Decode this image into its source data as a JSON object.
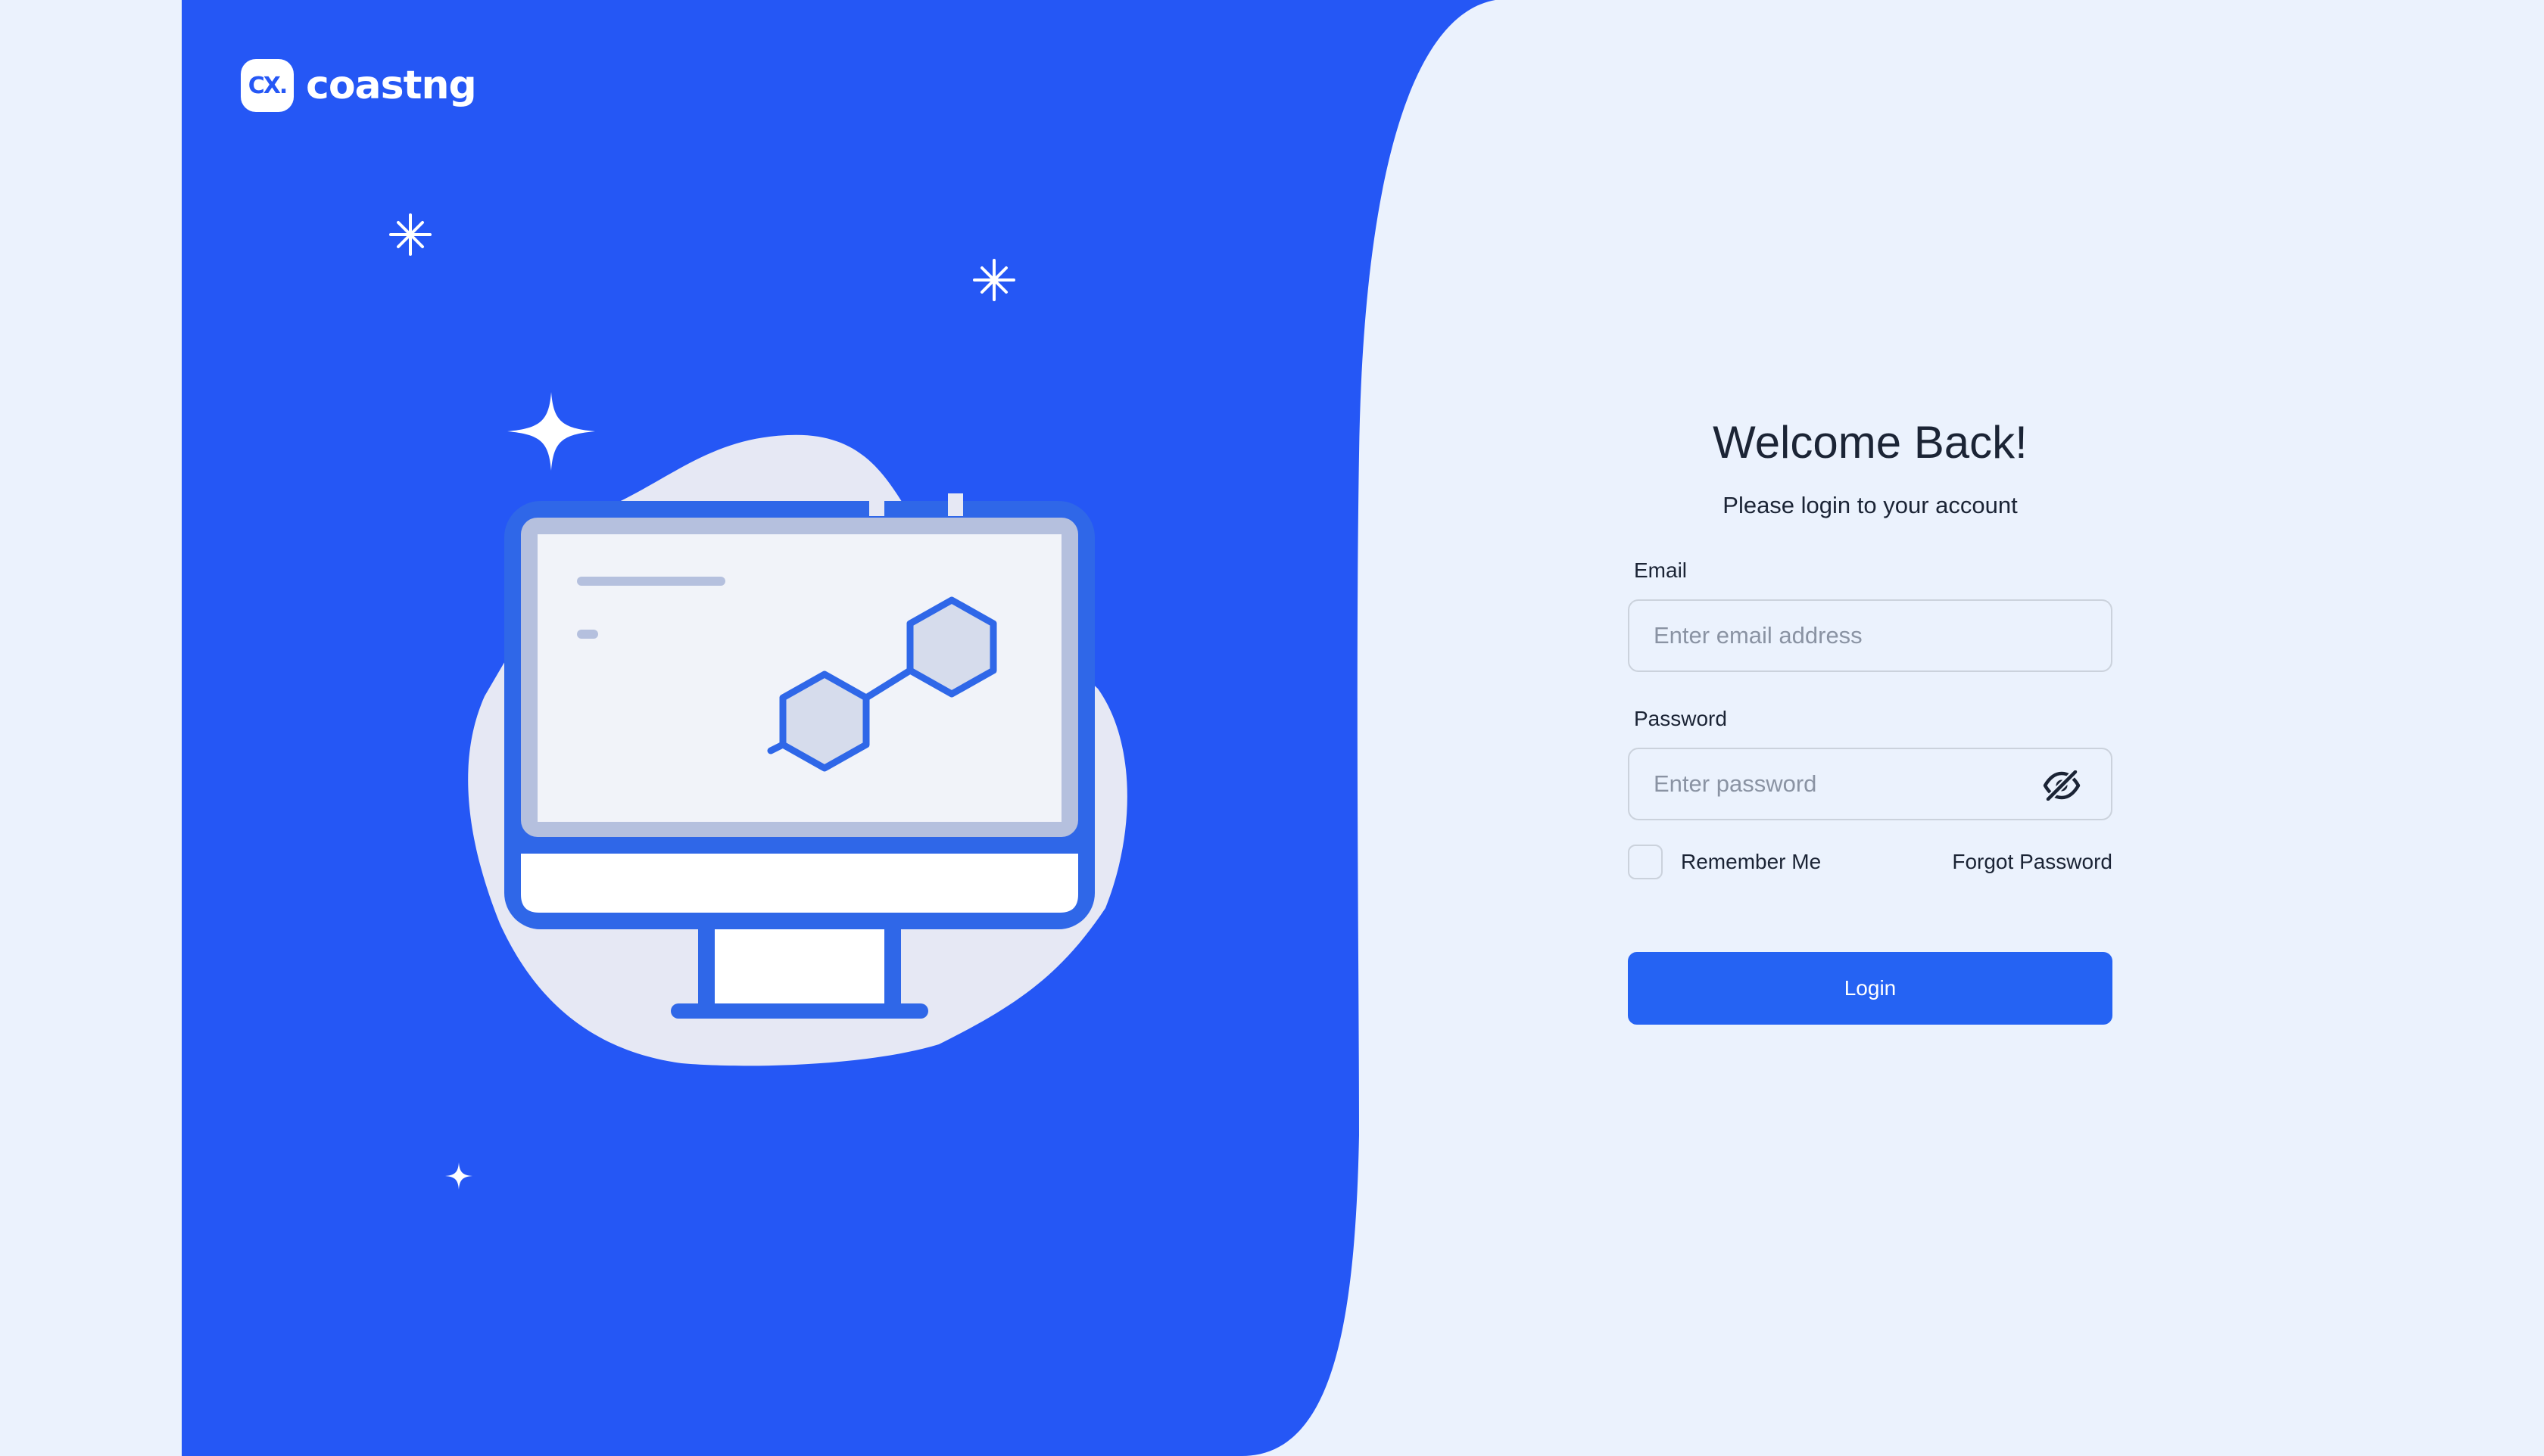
{
  "brand": {
    "badge": "CX.",
    "name": "coastng"
  },
  "login": {
    "title": "Welcome Back!",
    "subtitle": "Please login to your account",
    "email_label": "Email",
    "email_placeholder": "Enter email address",
    "email_value": "",
    "password_label": "Password",
    "password_placeholder": "Enter password",
    "password_value": "",
    "remember_label": "Remember Me",
    "remember_checked": false,
    "forgot_label": "Forgot Password",
    "login_button": "Login"
  },
  "colors": {
    "panel_blue": "#2557F5",
    "page_background": "#EBF2FD",
    "button_blue": "#2563F3"
  },
  "icons": [
    "eye-off-icon",
    "sparkle-icon",
    "monitor-illustration",
    "hexagon-icon"
  ]
}
